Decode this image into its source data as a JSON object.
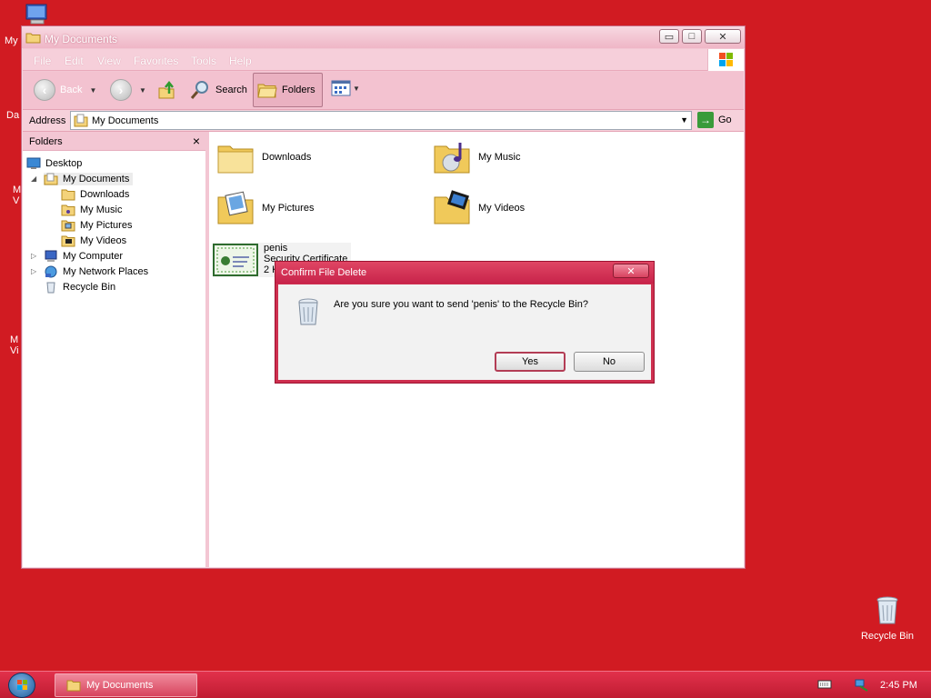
{
  "desktop": {
    "partial_labels": [
      "My",
      "Da",
      "M\nV",
      "M\nVi"
    ],
    "recycle_bin_label": "Recycle Bin"
  },
  "window": {
    "title": "My Documents",
    "controls": {
      "minimize": "▭",
      "maximize": "□",
      "close": "✕"
    },
    "menu": [
      "File",
      "Edit",
      "View",
      "Favorites",
      "Tools",
      "Help"
    ],
    "toolbar": {
      "back": "Back",
      "search": "Search",
      "folders": "Folders"
    },
    "address": {
      "label": "Address",
      "value": "My Documents",
      "go": "Go"
    }
  },
  "folders_pane": {
    "title": "Folders",
    "tree": [
      {
        "label": "Desktop",
        "level": 0
      },
      {
        "label": "My Documents",
        "level": 1
      },
      {
        "label": "Downloads",
        "level": 2
      },
      {
        "label": "My Music",
        "level": 2
      },
      {
        "label": "My Pictures",
        "level": 2
      },
      {
        "label": "My Videos",
        "level": 2
      },
      {
        "label": "My Computer",
        "level": 1
      },
      {
        "label": "My Network Places",
        "level": 1
      },
      {
        "label": "Recycle Bin",
        "level": 1
      }
    ]
  },
  "content": {
    "items": [
      {
        "name": "Downloads",
        "icon": "folder-icon"
      },
      {
        "name": "My Music",
        "icon": "music-folder-icon"
      },
      {
        "name": "My Pictures",
        "icon": "pictures-folder-icon"
      },
      {
        "name": "My Videos",
        "icon": "videos-folder-icon"
      }
    ],
    "file": {
      "name": "penis",
      "type": "Security Certificate",
      "size": "2 K"
    }
  },
  "dialog": {
    "title": "Confirm File Delete",
    "close": "✕",
    "message": "Are you sure you want to send 'penis' to the Recycle Bin?",
    "yes": "Yes",
    "no": "No"
  },
  "taskbar": {
    "task": "My Documents",
    "time": "2:45 PM"
  },
  "colors": {
    "desktop": "#d11b22",
    "window_frame": "#f3c6d3",
    "dialog_frame": "#ce2f4f",
    "taskbar": "#d02a40"
  }
}
